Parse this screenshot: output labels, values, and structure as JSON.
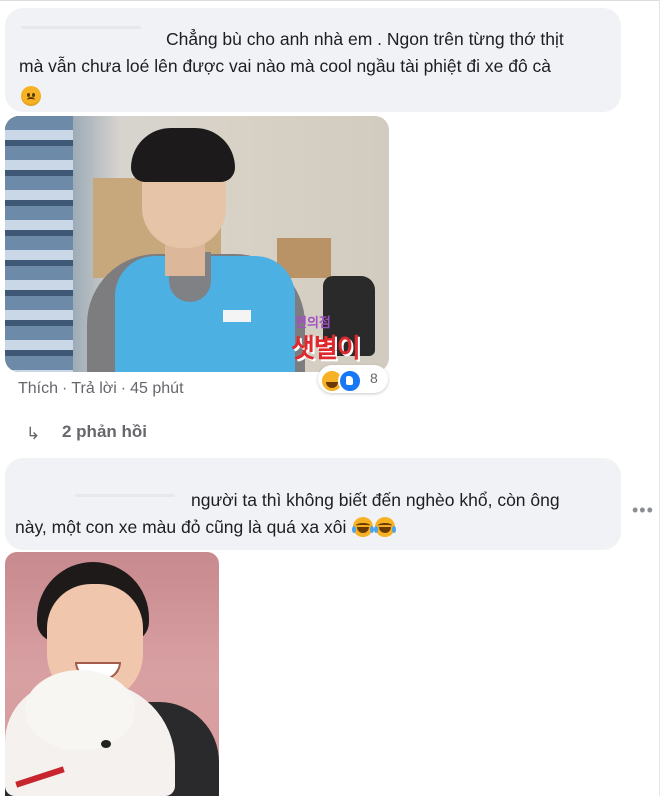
{
  "comment_1": {
    "text_line_1": "Chẳng bù cho anh nhà em . Ngon trên từng thớ thịt",
    "text_line_2": "mà vẫn chưa loé lên được vai nào mà cool ngầu tài phiệt đi xe đô cà",
    "emoji": "sad-face-icon",
    "image_overlay_top": "편의점",
    "image_overlay_bottom": "샛별이",
    "actions": {
      "like": "Thích",
      "reply": "Trả lời",
      "time": "45 phút"
    },
    "reactions": {
      "types": [
        "haha",
        "like"
      ],
      "count": "8"
    },
    "replies_label": "2 phản hồi"
  },
  "comment_2": {
    "text_line_1": "người ta thì không biết đến nghèo khổ, còn ông",
    "text_line_2": "này, một con xe màu đỏ cũng là quá xa xôi",
    "emoji": [
      "laughing-tears-icon",
      "laughing-tears-icon"
    ],
    "more_menu": "•••"
  },
  "colors": {
    "bubble_bg": "#f0f2f5",
    "meta_text": "#65676b",
    "like_blue": "#1877f2",
    "haha_yellow": "#f7b125"
  }
}
